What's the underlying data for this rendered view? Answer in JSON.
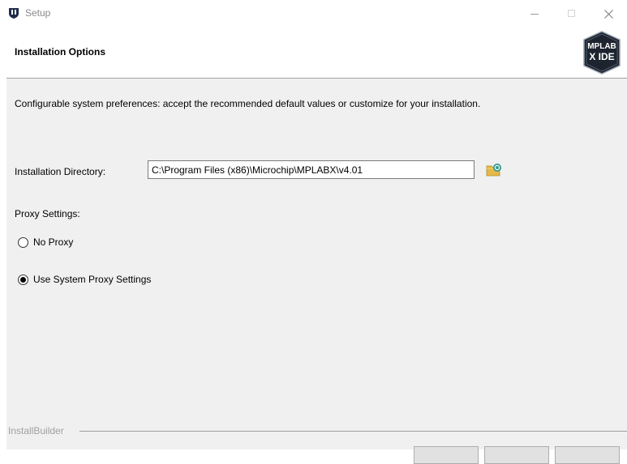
{
  "window": {
    "title": "Setup"
  },
  "header": {
    "title": "Installation Options",
    "logo_text_top": "MPLAB",
    "logo_text_bottom": "X IDE"
  },
  "main": {
    "description": "Configurable system preferences: accept the recommended default values or customize for your installation.",
    "install_dir_label": "Installation Directory:",
    "install_dir_value": "C:\\Program Files (x86)\\Microchip\\MPLABX\\v4.01",
    "proxy_label": "Proxy Settings:",
    "proxy_options": [
      {
        "label": "No Proxy",
        "selected": false
      },
      {
        "label": "Use System Proxy Settings",
        "selected": true
      }
    ]
  },
  "footer": {
    "brand": "InstallBuilder"
  },
  "icons": {
    "app": "shield-icon",
    "browse": "folder-browse-icon",
    "minimize": "minimize-icon",
    "maximize": "maximize-icon",
    "close": "close-icon"
  },
  "colors": {
    "content_bg": "#f0f0f0",
    "folder": "#e3b94a",
    "accent_teal": "#2f9a8f"
  }
}
